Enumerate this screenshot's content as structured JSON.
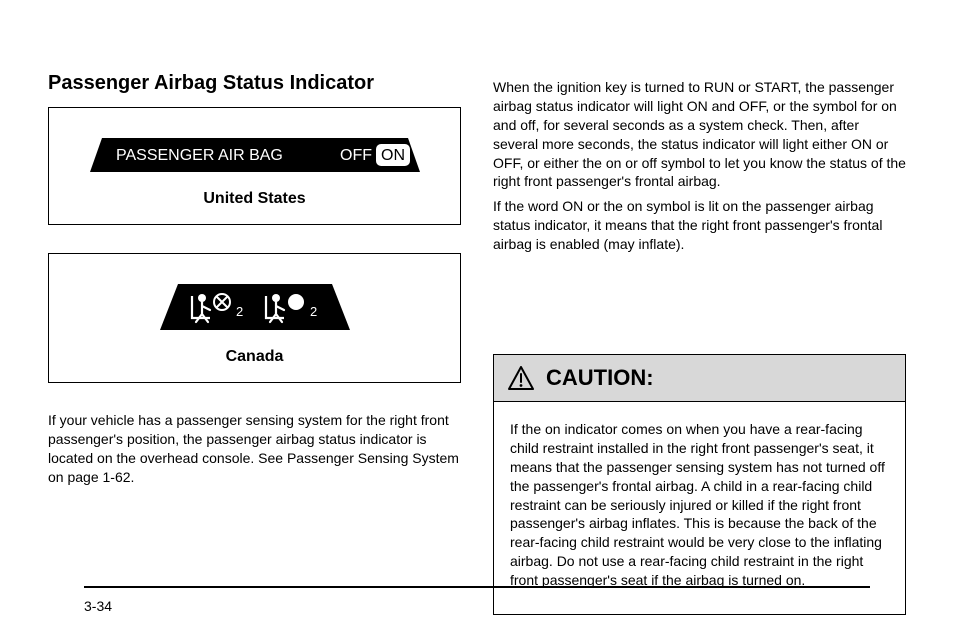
{
  "section_title": "Passenger Airbag Status Indicator",
  "figure1": {
    "label": "PASSENGER AIR BAG",
    "off": "OFF",
    "on": "ON",
    "caption": "United States"
  },
  "figure2": {
    "caption": "Canada"
  },
  "left_paragraphs": [
    "If your vehicle has a passenger sensing system for the right front passenger's position, the passenger airbag status indicator is located on the overhead console. See Passenger Sensing System on page 1-62."
  ],
  "right_paragraphs_top": [
    "When the ignition key is turned to RUN or START, the passenger airbag status indicator will light ON and OFF, or the symbol for on and off, for several seconds as a system check. Then, after several more seconds, the status indicator will light either ON or OFF, or either the on or off symbol to let you know the status of the right front passenger's frontal airbag.",
    "If the word ON or the on symbol is lit on the passenger airbag status indicator, it means that the right front passenger's frontal airbag is enabled (may inflate)."
  ],
  "caution": {
    "heading": "CAUTION:",
    "paragraphs": [
      "If the on indicator comes on when you have a rear-facing child restraint installed in the right front passenger's seat, it means that the passenger sensing system has not turned off the passenger's frontal airbag. A child in a rear-facing child restraint can be seriously injured or killed if the right front passenger's airbag inflates. This is because the back of the rear-facing child restraint would be very close to the inflating airbag. Do not use a rear-facing child restraint in the right front passenger's seat if the airbag is turned on."
    ]
  },
  "page_number": "3-34"
}
